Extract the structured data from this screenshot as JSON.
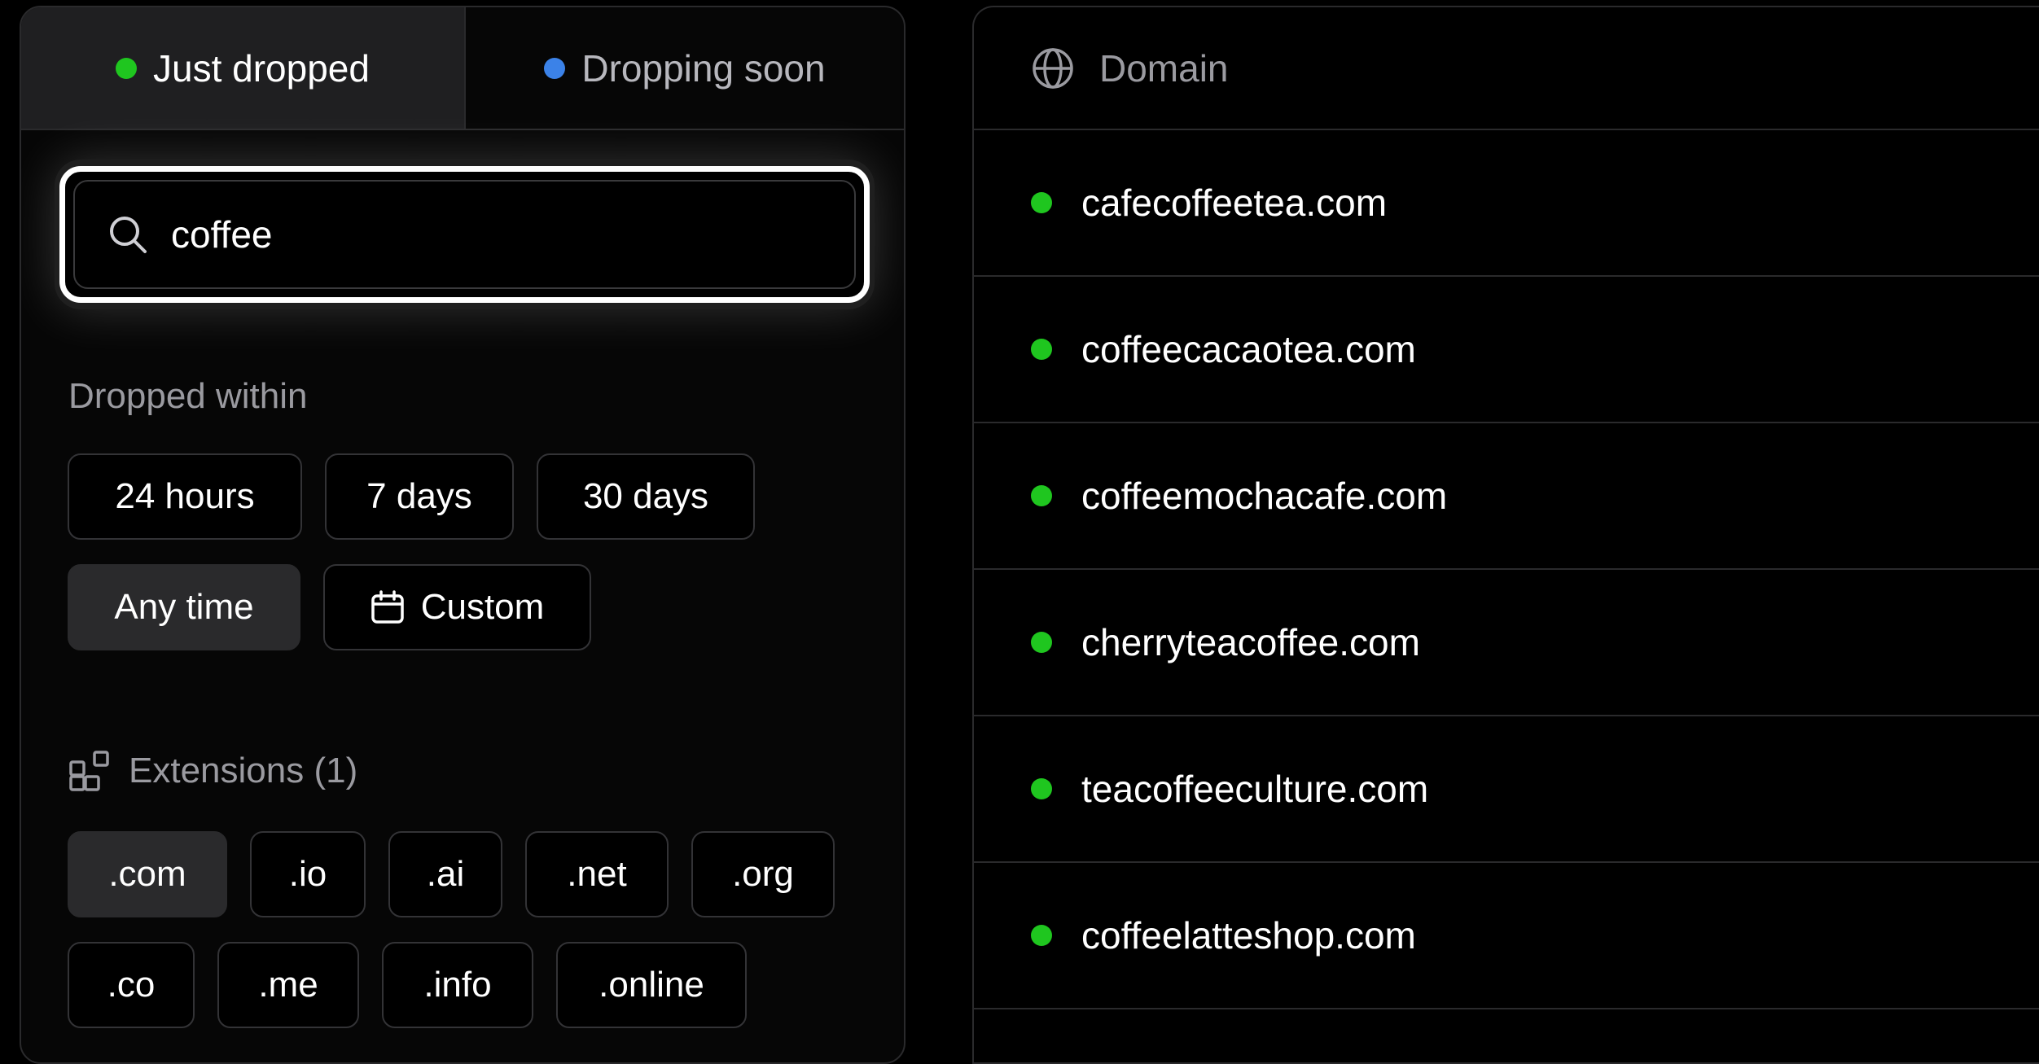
{
  "colors": {
    "just_dropped_dot": "#1fc61f",
    "dropping_soon_dot": "#3b82e8"
  },
  "tabs": [
    {
      "label": "Just dropped",
      "active": true
    },
    {
      "label": "Dropping soon",
      "active": false
    }
  ],
  "search": {
    "value": "coffee",
    "icon": "search-icon"
  },
  "dropped_within": {
    "label": "Dropped within",
    "options": [
      {
        "label": "24 hours",
        "selected": false
      },
      {
        "label": "7 days",
        "selected": false
      },
      {
        "label": "30 days",
        "selected": false
      },
      {
        "label": "Any time",
        "selected": true
      },
      {
        "label": "Custom",
        "selected": false,
        "icon": "calendar-icon"
      }
    ]
  },
  "extensions": {
    "label": "Extensions (1)",
    "icon": "extensions-icon",
    "options": [
      {
        "label": ".com",
        "selected": true
      },
      {
        "label": ".io",
        "selected": false
      },
      {
        "label": ".ai",
        "selected": false
      },
      {
        "label": ".net",
        "selected": false
      },
      {
        "label": ".org",
        "selected": false
      },
      {
        "label": ".co",
        "selected": false
      },
      {
        "label": ".me",
        "selected": false
      },
      {
        "label": ".info",
        "selected": false
      },
      {
        "label": ".online",
        "selected": false
      }
    ]
  },
  "table": {
    "header": {
      "label": "Domain",
      "icon": "globe-icon"
    },
    "rows": [
      {
        "domain": "cafecoffeetea.com",
        "status": "just-dropped"
      },
      {
        "domain": "coffeecacaotea.com",
        "status": "just-dropped"
      },
      {
        "domain": "coffeemochacafe.com",
        "status": "just-dropped"
      },
      {
        "domain": "cherryteacoffee.com",
        "status": "just-dropped"
      },
      {
        "domain": "teacoffeeculture.com",
        "status": "just-dropped"
      },
      {
        "domain": "coffeelatteshop.com",
        "status": "just-dropped"
      }
    ]
  }
}
